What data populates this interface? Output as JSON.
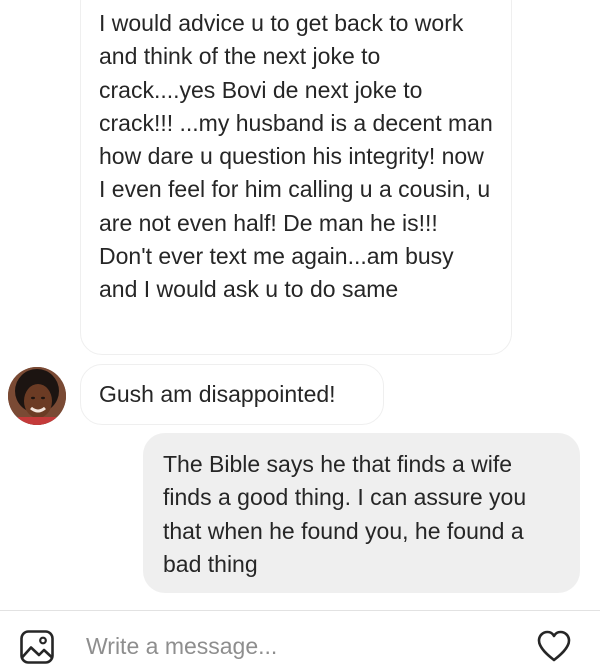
{
  "messages": [
    {
      "direction": "incoming",
      "text": "I would advice u to get back to work and think of the next joke to crack....yes Bovi de next joke to crack!!! ...my husband is a decent man how dare u question his integrity!  now I even feel for him calling u a cousin, u are not even half! De man he is!!! Don't ever text me again...am busy and I would ask u to do same"
    },
    {
      "direction": "incoming",
      "text": "Gush am disappointed!"
    },
    {
      "direction": "outgoing",
      "text": "The Bible says he that finds a wife finds a good thing. I can assure you that when he found you, he found a bad thing"
    }
  ],
  "composer": {
    "placeholder": "Write a message...",
    "value": "",
    "left_icon": "gallery-icon",
    "right_icon": "heart-icon"
  },
  "colors": {
    "outgoing_bubble": "#efefef",
    "incoming_border": "#efefef",
    "text": "#262626",
    "placeholder": "#8e8e8e",
    "icon": "#262626"
  }
}
